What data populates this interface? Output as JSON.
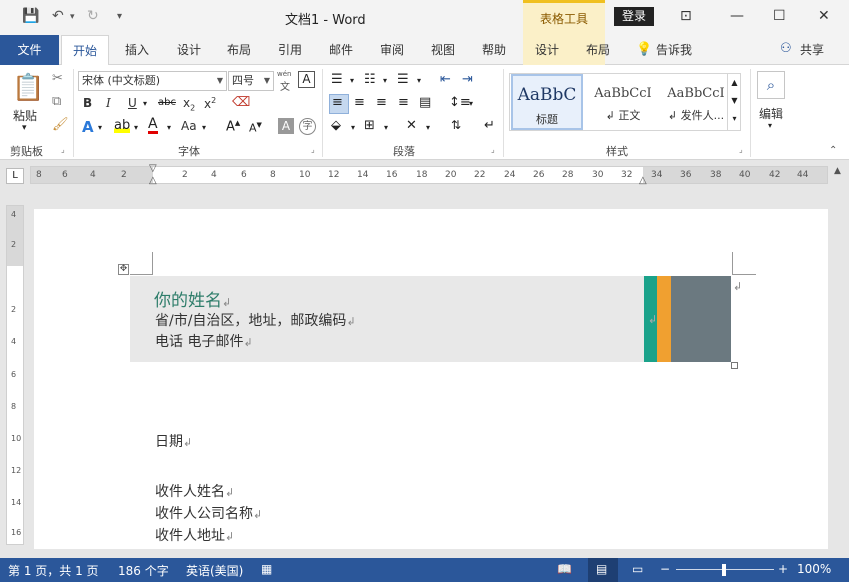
{
  "window": {
    "title": "文档1  -  Word",
    "context_tools": "表格工具",
    "login": "登录"
  },
  "tabs": {
    "file": "文件",
    "home": "开始",
    "insert": "插入",
    "design": "设计",
    "layout": "布局",
    "references": "引用",
    "mailings": "邮件",
    "review": "审阅",
    "view": "视图",
    "help": "帮助",
    "table_design": "设计",
    "table_layout": "布局",
    "tell_me": "告诉我",
    "share": "共享"
  },
  "ribbon": {
    "paste": "粘贴",
    "font_name": "宋体 (中文标题)",
    "font_size": "四号",
    "wen": "wén",
    "wen2": "文",
    "groups": {
      "clipboard": "剪贴板",
      "font": "字体",
      "paragraph": "段落",
      "styles": "样式"
    },
    "styles": [
      {
        "sample": "AaBbC",
        "name": "标题"
      },
      {
        "sample": "AaBbCcI",
        "name": "↲ 正文"
      },
      {
        "sample": "AaBbCcI",
        "name": "↲ 发件人..."
      }
    ],
    "edit": "编辑"
  },
  "ruler": {
    "h_ticks": [
      "8",
      "6",
      "4",
      "2",
      "",
      "2",
      "4",
      "6",
      "8",
      "10",
      "12",
      "14",
      "16",
      "18",
      "20",
      "22",
      "24",
      "26",
      "28",
      "30",
      "32",
      "34",
      "36",
      "38",
      "40",
      "42",
      "44"
    ],
    "v_ticks": [
      "4",
      "2",
      "",
      "2",
      "4",
      "6",
      "8",
      "10",
      "12",
      "14",
      "16"
    ]
  },
  "document": {
    "name": "你的姓名",
    "address": "省/市/自治区，地址，邮政编码",
    "contact": "电话   电子邮件",
    "date": "日期",
    "recipient_name": "收件人姓名",
    "recipient_company": "收件人公司名称",
    "recipient_address": "收件人地址"
  },
  "status": {
    "page": "第 1 页，共 1 页",
    "words": "186 个字",
    "lang": "英语(美国)",
    "zoom": "100%"
  },
  "colors": {
    "accent": "#2b579a",
    "green_bar": "#1aa28a",
    "orange_bar": "#f0a030",
    "gray_bar": "#6b7980",
    "name_color": "#2e7d6a"
  }
}
